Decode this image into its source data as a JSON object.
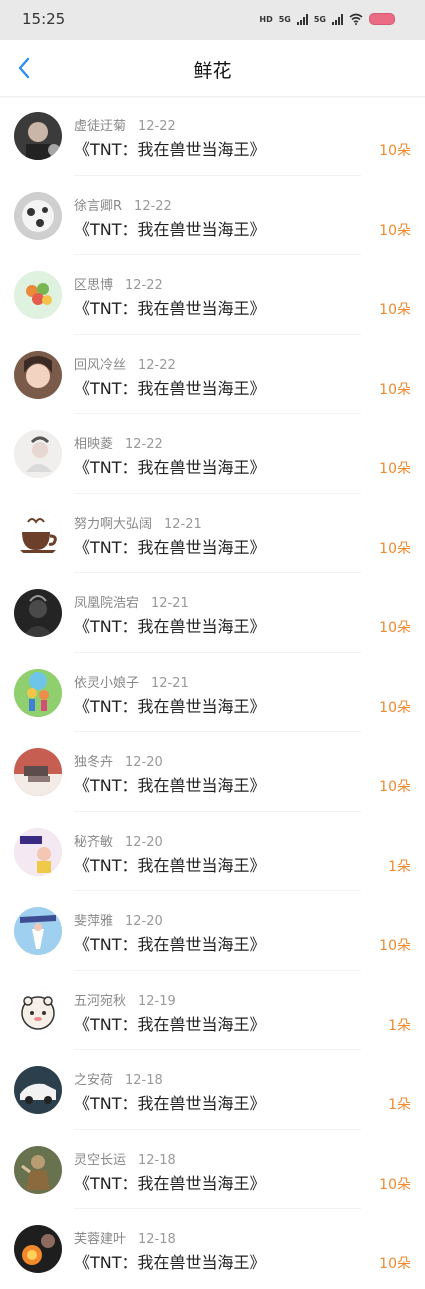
{
  "status": {
    "time": "15:25",
    "network_label": "HD",
    "signal_1": "5G",
    "signal_2": "5G"
  },
  "header": {
    "title": "鲜花"
  },
  "rows": [
    {
      "name": "虚徒迂菊",
      "date": "12-22",
      "book": "《TNT：我在兽世当海王》",
      "count": "10朵",
      "avatar": "avatar-dark-photo"
    },
    {
      "name": "徐言卿R",
      "date": "12-22",
      "book": "《TNT：我在兽世当海王》",
      "count": "10朵",
      "avatar": "avatar-spots"
    },
    {
      "name": "区思博",
      "date": "12-22",
      "book": "《TNT：我在兽世当海王》",
      "count": "10朵",
      "avatar": "avatar-balloons"
    },
    {
      "name": "回风冷丝",
      "date": "12-22",
      "book": "《TNT：我在兽世当海王》",
      "count": "10朵",
      "avatar": "avatar-girl"
    },
    {
      "name": "相映菱",
      "date": "12-22",
      "book": "《TNT：我在兽世当海王》",
      "count": "10朵",
      "avatar": "avatar-sketch"
    },
    {
      "name": "努力啊大弘阔",
      "date": "12-21",
      "book": "《TNT：我在兽世当海王》",
      "count": "10朵",
      "avatar": "avatar-coffee"
    },
    {
      "name": "凤凰院浩宕",
      "date": "12-21",
      "book": "《TNT：我在兽世当海王》",
      "count": "10朵",
      "avatar": "avatar-dark"
    },
    {
      "name": "依灵小娘子",
      "date": "12-21",
      "book": "《TNT：我在兽世当海王》",
      "count": "10朵",
      "avatar": "avatar-cartoon"
    },
    {
      "name": "独冬卉",
      "date": "12-20",
      "book": "《TNT：我在兽世当海王》",
      "count": "10朵",
      "avatar": "avatar-room"
    },
    {
      "name": "秘齐敏",
      "date": "12-20",
      "book": "《TNT：我在兽世当海王》",
      "count": "1朵",
      "avatar": "avatar-fila"
    },
    {
      "name": "斐萍雅",
      "date": "12-20",
      "book": "《TNT：我在兽世当海王》",
      "count": "10朵",
      "avatar": "avatar-sky"
    },
    {
      "name": "五河宛秋",
      "date": "12-19",
      "book": "《TNT：我在兽世当海王》",
      "count": "1朵",
      "avatar": "avatar-bear"
    },
    {
      "name": "之安荷",
      "date": "12-18",
      "book": "《TNT：我在兽世当海王》",
      "count": "1朵",
      "avatar": "avatar-car"
    },
    {
      "name": "灵空长运",
      "date": "12-18",
      "book": "《TNT：我在兽世当海王》",
      "count": "10朵",
      "avatar": "avatar-warrior"
    },
    {
      "name": "芙蓉建叶",
      "date": "12-18",
      "book": "《TNT：我在兽世当海王》",
      "count": "10朵",
      "avatar": "avatar-fire"
    }
  ],
  "colors": {
    "accent_blue": "#2f8ef0",
    "flower_count": "#ef8a2f",
    "status_bar_bg": "#e9e9e9"
  }
}
